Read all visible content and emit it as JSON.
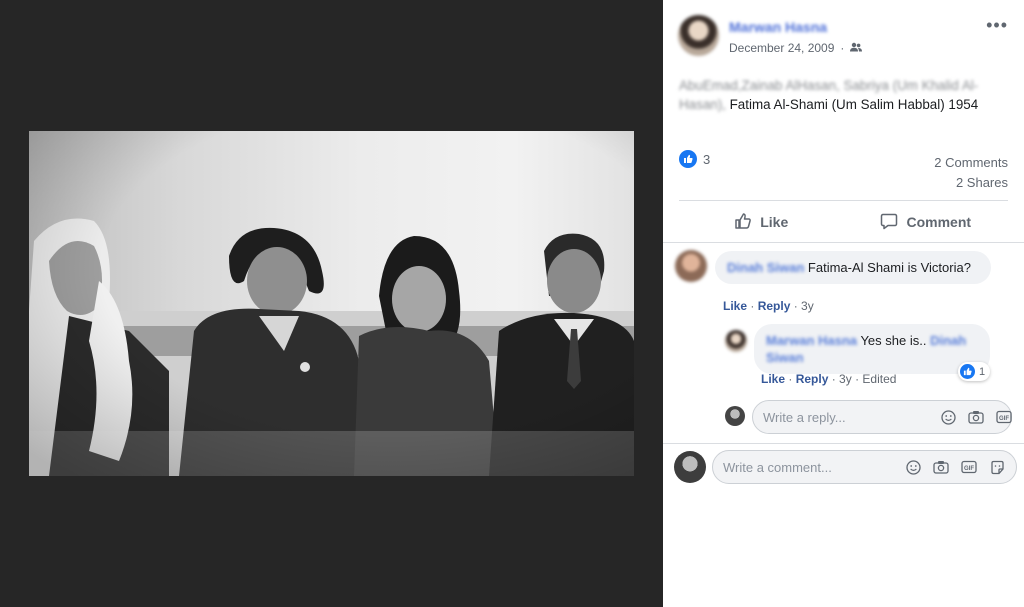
{
  "post": {
    "author": "Marwan Hasna",
    "date": "December 24, 2009",
    "audience_icon": "friends-icon",
    "caption_blurred": "AbuEmad,Zainab AlHasan, Sabriya (Um Khalid Al-Hasan),",
    "caption_visible": "Fatima Al-Shami (Um Salim Habbal) 1954",
    "like_count": "3",
    "comments_count": "2 Comments",
    "shares_count": "2 Shares"
  },
  "actions": {
    "like_label": "Like",
    "comment_label": "Comment"
  },
  "comments": [
    {
      "author": "Dinah Siwan",
      "text": "Fatima-Al Shami is Victoria?",
      "like": "Like",
      "reply": "Reply",
      "time": "3y"
    }
  ],
  "reply": {
    "author": "Marwan Hasna",
    "text": "Yes she is..",
    "mention": "Dinah Siwan",
    "like": "Like",
    "reply": "Reply",
    "time": "3y",
    "edited": "Edited",
    "reaction_count": "1"
  },
  "reply_input": {
    "placeholder": "Write a reply..."
  },
  "comment_input": {
    "placeholder": "Write a comment..."
  },
  "colors": {
    "viewer_bg": "#262626",
    "link": "#365899",
    "like_blue": "#1877f2",
    "bubble_bg": "#f0f2f5"
  }
}
